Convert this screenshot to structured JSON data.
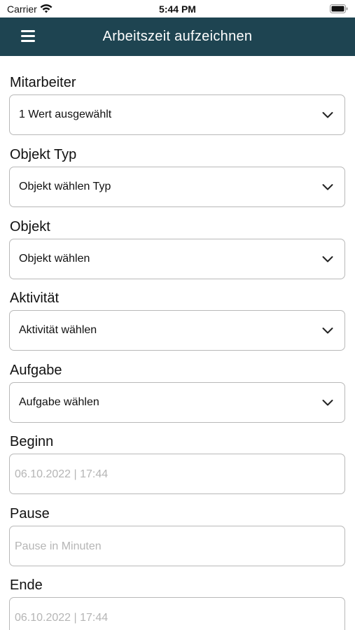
{
  "status_bar": {
    "carrier": "Carrier",
    "time": "5:44 PM"
  },
  "nav": {
    "title": "Arbeitszeit aufzeichnen",
    "background": "#1e4451"
  },
  "fields": {
    "mitarbeiter": {
      "label": "Mitarbeiter",
      "value": "1 Wert ausgewählt"
    },
    "objekt_typ": {
      "label": "Objekt Typ",
      "value": "Objekt wählen Typ"
    },
    "objekt": {
      "label": "Objekt",
      "value": "Objekt wählen"
    },
    "aktivitaet": {
      "label": "Aktivität",
      "value": "Aktivität wählen"
    },
    "aufgabe": {
      "label": "Aufgabe",
      "value": "Aufgabe wählen"
    },
    "beginn": {
      "label": "Beginn",
      "placeholder": "06.10.2022 | 17:44"
    },
    "pause": {
      "label": "Pause",
      "placeholder": "Pause in Minuten"
    },
    "ende": {
      "label": "Ende",
      "placeholder": "06.10.2022 | 17:44"
    }
  }
}
